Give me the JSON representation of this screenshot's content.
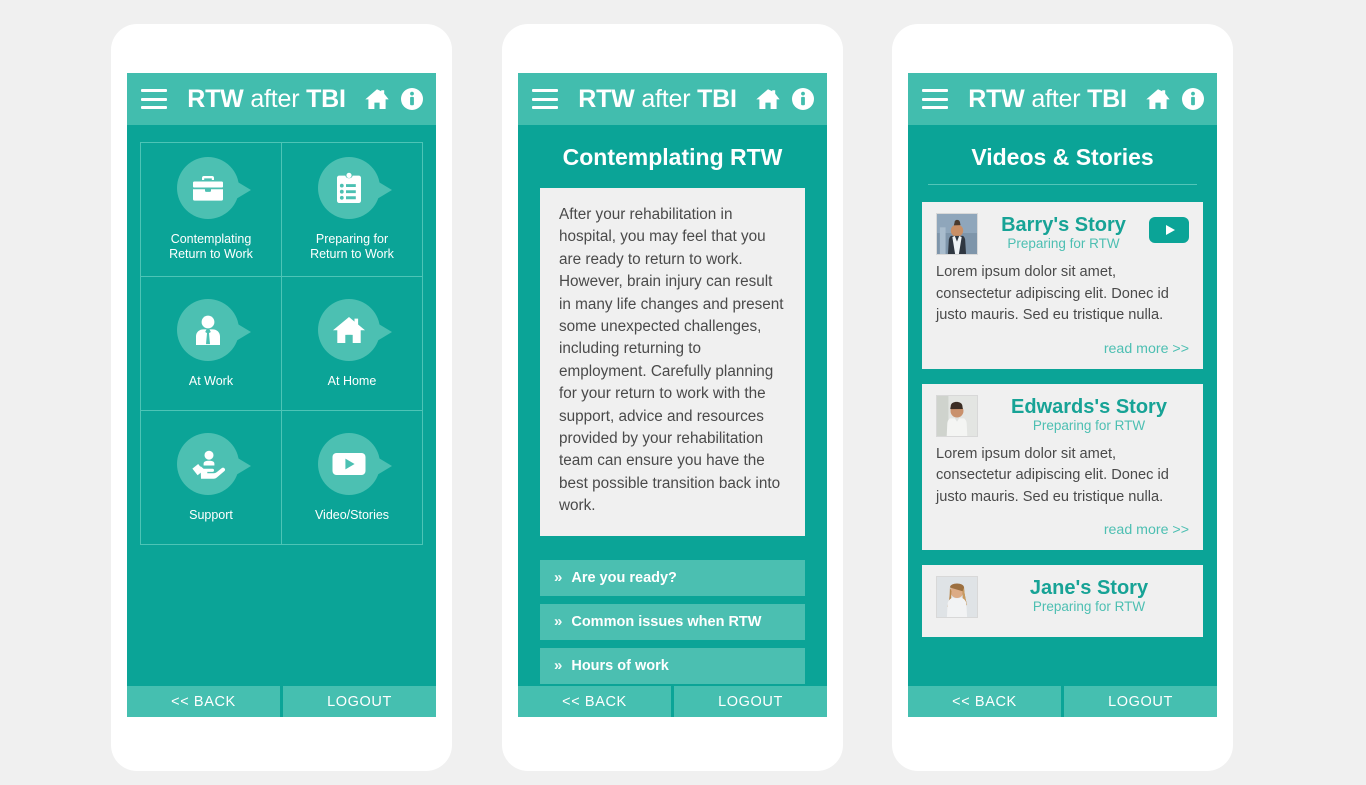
{
  "app": {
    "title_bold_1": "RTW",
    "title_light": "after",
    "title_bold_2": "TBI",
    "menu_icon": "hamburger-menu-icon",
    "home_icon": "home-icon",
    "info_icon": "info-icon",
    "accent_light": "#42bdae",
    "accent_dark": "#0ba497",
    "page_background": "#f0f0f0"
  },
  "bottom_bar": {
    "back_label": "<< BACK",
    "logout_label": "LOGOUT"
  },
  "screen_home": {
    "tiles": [
      {
        "label": "Contemplating\nReturn to Work",
        "icon": "briefcase-icon"
      },
      {
        "label": "Preparing for\nReturn to Work",
        "icon": "clipboard-checklist-icon"
      },
      {
        "label": "At Work",
        "icon": "person-tie-icon"
      },
      {
        "label": "At Home",
        "icon": "house-icon"
      },
      {
        "label": "Support",
        "icon": "helping-hand-icon"
      },
      {
        "label": "Video/Stories",
        "icon": "video-play-icon"
      }
    ]
  },
  "screen_article": {
    "title": "Contemplating RTW",
    "body": "After your rehabilitation in hospital, you may feel that you are ready to return to work. However, brain injury can result in many life changes and present some unexpected challenges, including returning to employment. Carefully planning for your return to work with the support, advice and resources provided by your rehabilitation team can ensure you have the best possible transition back into work.",
    "links": [
      {
        "label": "Are you ready?",
        "chevron": "»"
      },
      {
        "label": "Common issues when RTW",
        "chevron": "»"
      },
      {
        "label": "Hours of work",
        "chevron": "»"
      }
    ]
  },
  "screen_stories": {
    "title": "Videos & Stories",
    "read_more_label": "read more >>",
    "cards": [
      {
        "name": "Barry's Story",
        "subtitle": "Preparing for RTW",
        "body": "Lorem ipsum dolor sit amet, consectetur adipiscing elit. Donec id justo mauris. Sed eu tristique nulla.",
        "has_play_button": true,
        "avatar": "photo-man-dark-suit"
      },
      {
        "name": "Edwards's Story",
        "subtitle": "Preparing for RTW",
        "body": "Lorem ipsum dolor sit amet, consectetur adipiscing elit. Donec id justo mauris. Sed eu tristique nulla.",
        "has_play_button": false,
        "avatar": "photo-man-white-shirt"
      },
      {
        "name": "Jane's Story",
        "subtitle": "Preparing for RTW",
        "body": "",
        "has_play_button": false,
        "avatar": "photo-woman-blonde"
      }
    ]
  }
}
